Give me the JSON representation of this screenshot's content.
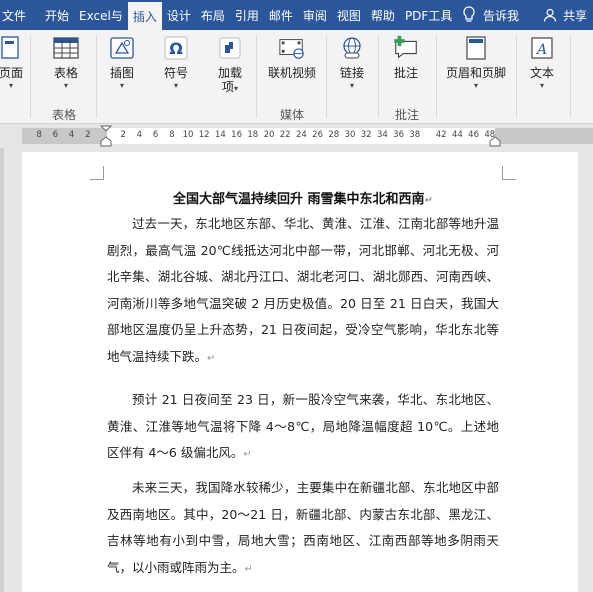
{
  "tabs": [
    "文件",
    "开始",
    "Excel与",
    "插入",
    "设计",
    "布局",
    "引用",
    "邮件",
    "审阅",
    "视图",
    "帮助",
    "PDF工具"
  ],
  "active_tab": "插入",
  "tell_me": "告诉我",
  "share": "共享",
  "ribbon": {
    "pages": "页面",
    "table": "表格",
    "illustrations": "插图",
    "symbols": "符号",
    "addins": "加载\n项",
    "online_video": "联机视频",
    "link": "链接",
    "comment": "批注",
    "header_footer": "页眉和页脚",
    "text": "文本"
  },
  "groups": {
    "table": "表格",
    "media": "媒体",
    "comments": "批注"
  },
  "ruler_left": [
    "8",
    "6",
    "4",
    "2"
  ],
  "ruler_right": [
    "2",
    "4",
    "6",
    "8",
    "10",
    "12",
    "14",
    "16",
    "18",
    "20",
    "22",
    "24",
    "26",
    "28",
    "30",
    "32",
    "34",
    "36",
    "38"
  ],
  "ruler_far": [
    "42",
    "44",
    "46",
    "48"
  ],
  "document": {
    "title": "全国大部气温持续回升 雨雪集中东北和西南",
    "paragraphs": [
      "过去一天，东北地区东部、华北、黄淮、江淮、江南北部等地升温剧烈，最高气温 20℃线抵达河北中部一带，河北邯郸、河北无极、河北辛集、湖北谷城、湖北丹江口、湖北老河口、湖北郧西、河南西峡、河南淅川等多地气温突破 2 月历史极值。20 日至 21 日白天，我国大部地区温度仍呈上升态势，21 日夜间起，受冷空气影响，华北东北等地气温持续下跌。",
      "预计 21 日夜间至 23 日，新一股冷空气来袭，华北、东北地区、黄淮、江淮等地气温将下降 4～8℃，局地降温幅度超 10℃。上述地区伴有 4～6 级偏北风。",
      "未来三天，我国降水较稀少，主要集中在新疆北部、东北地区中部及西南地区。其中，20～21 日，新疆北部、内蒙古东北部、黑龙江、吉林等地有小到中雪，局地大雪；西南地区、江南西部等地多阴雨天气，以小雨或阵雨为主。"
    ],
    "para_mark": "↵"
  },
  "colors": {
    "brand": "#2b579a",
    "ribbon_bg": "#f3f3f3"
  }
}
